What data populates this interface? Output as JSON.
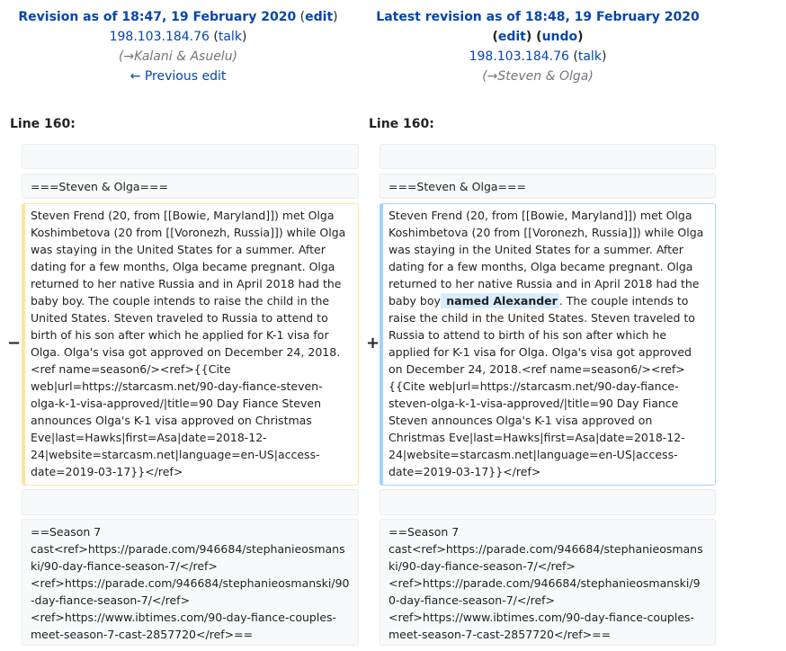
{
  "left_header": {
    "title": "Revision as of 18:47, 19 February 2020",
    "edit": "edit",
    "user": "198.103.184.76",
    "talk": "talk",
    "comment_arrow": "→",
    "comment": "Kalani & Asuelu",
    "previous_edit": "← Previous edit"
  },
  "right_header": {
    "title": "Latest revision as of 18:48, 19 February 2020",
    "edit": "edit",
    "undo": "undo",
    "user": "198.103.184.76",
    "talk": "talk",
    "comment_arrow": "→",
    "comment": "Steven & Olga"
  },
  "line_label_left": "Line 160:",
  "line_label_right": "Line 160:",
  "markers": {
    "minus": "−",
    "plus": "+"
  },
  "rows": {
    "empty": "",
    "section_heading": "===Steven & Olga===",
    "deleted_text": "Steven Frend (20, from [[Bowie, Maryland]]) met Olga Koshimbetova (20 from [[Voronezh, Russia]]) while Olga was staying in the United States for a summer. After dating for a few months, Olga became pregnant. Olga returned to her native Russia and in April 2018 had the baby boy. The couple intends to raise the child in the United States. Steven traveled to Russia to attend to birth of his son after which he applied for K-1 visa for Olga. Olga's visa got approved on December 24, 2018.<ref name=season6/><ref>{{Cite web|url=https://starcasm.net/90-day-fiance-steven-olga-k-1-visa-approved/|title=90 Day Fiance Steven announces Olga's K-1 visa approved on Christmas Eve|last=Hawks|first=Asa|date=2018-12-24|website=starcasm.net|language=en-US|access-date=2019-03-17}}</ref>",
    "added_before": "Steven Frend (20, from [[Bowie, Maryland]]) met Olga Koshimbetova (20 from [[Voronezh, Russia]]) while Olga was staying in the United States for a summer. After dating for a few months, Olga became pregnant. Olga returned to her native Russia and in April 2018 had the baby boy",
    "added_insert": " named Alexander",
    "added_after": ". The couple intends to raise the child in the United States. Steven traveled to Russia to attend to birth of his son after which he applied for K-1 visa for Olga. Olga's visa got approved on December 24, 2018.<ref name=season6/><ref>{{Cite web|url=https://starcasm.net/90-day-fiance-steven-olga-k-1-visa-approved/|title=90 Day Fiance Steven announces Olga's K-1 visa approved on Christmas Eve|last=Hawks|first=Asa|date=2018-12-24|website=starcasm.net|language=en-US|access-date=2019-03-17}}</ref>",
    "season7_line1": "==Season 7",
    "season7_line2": "cast<ref>https://parade.com/946684/stephanieosmanski/90-day-fiance-season-7/</ref>",
    "season7_line3": "<ref>https://parade.com/946684/stephanieosmanski/90-day-fiance-season-7/</ref>",
    "season7_line4": "<ref>https://www.ibtimes.com/90-day-fiance-couples-meet-season-7-cast-2857720</ref>=="
  }
}
